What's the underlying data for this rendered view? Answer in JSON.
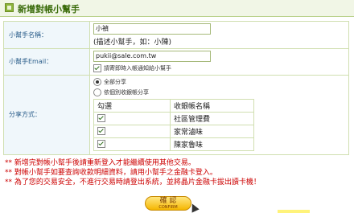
{
  "header": {
    "title": "新增對帳小幫手"
  },
  "form": {
    "name_label": "小幫手名稱：",
    "name_value": "小禎",
    "name_hint": "(描述小幫手，如：小陳)",
    "email_label": "小幫手Email：",
    "email_value": "pukii@sale.com.tw",
    "email_checkbox_label": "請寄即時入帳通知給小幫手",
    "share_label": "分享方式：",
    "share_options": [
      "全部分享",
      "依個別收銀帳分享"
    ],
    "share_table": {
      "headers": [
        "勾選",
        "收銀帳名稱"
      ],
      "rows": [
        {
          "checked": true,
          "name": "社區管理費"
        },
        {
          "checked": true,
          "name": "家常滷味"
        },
        {
          "checked": true,
          "name": "陳家魯味"
        }
      ]
    }
  },
  "notes": [
    "** 新增完對帳小幫手後請重新登入才能繼續使用其他交易。",
    "** 對帳小幫手如要查詢收款明細資料，請用小幫手之金融卡登入。",
    "** 為了您的交易安全，不進行交易時請登出系統，並將晶片金融卡拔出讀卡機！"
  ],
  "confirm": {
    "label": "確 認",
    "sub": "CONFIRM"
  }
}
